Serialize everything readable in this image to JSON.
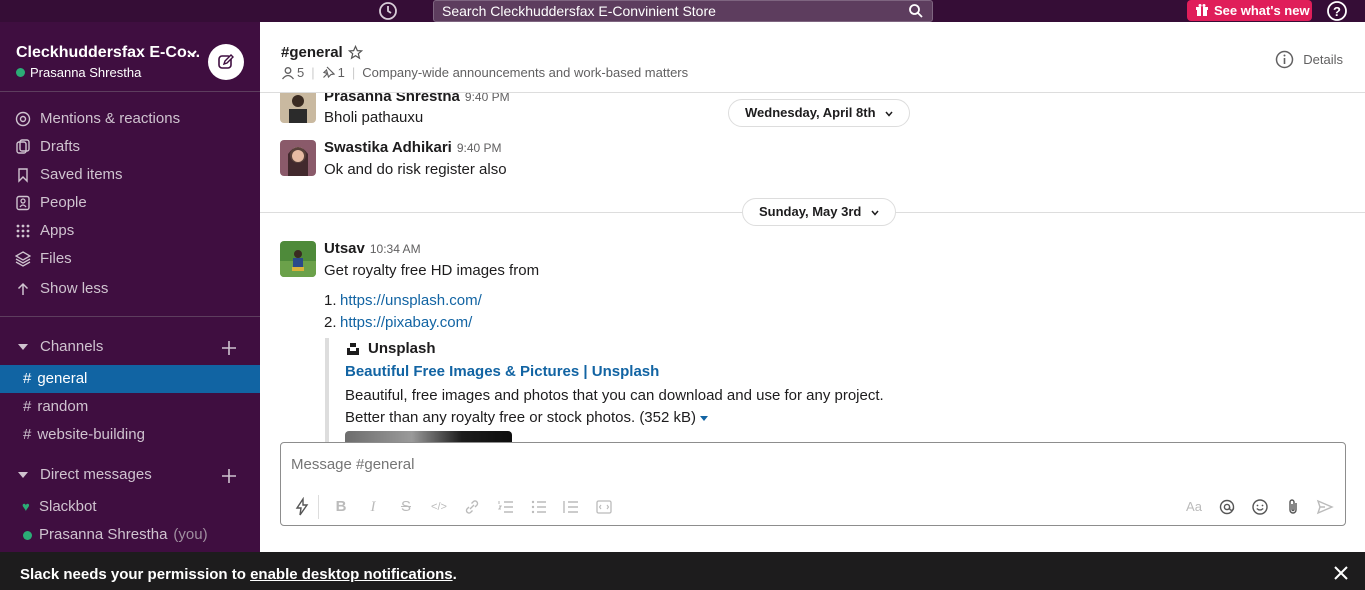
{
  "topbar": {
    "search_text": "Search Cleckhuddersfax E-Convinient Store",
    "whats_new_label": "See what's new"
  },
  "sidebar": {
    "workspace_name": "Cleckhuddersfax E-Co...",
    "current_user": "Prasanna Shrestha",
    "nav": [
      {
        "label": "Mentions & reactions",
        "icon": "at-icon"
      },
      {
        "label": "Drafts",
        "icon": "drafts-icon"
      },
      {
        "label": "Saved items",
        "icon": "bookmark-icon"
      },
      {
        "label": "People",
        "icon": "people-icon"
      },
      {
        "label": "Apps",
        "icon": "apps-grid-icon"
      },
      {
        "label": "Files",
        "icon": "files-stack-icon"
      },
      {
        "label": "Show less",
        "icon": "arrow-up-icon"
      }
    ],
    "channels_header": "Channels",
    "channels": [
      {
        "name": "general",
        "active": true
      },
      {
        "name": "random",
        "active": false
      },
      {
        "name": "website-building",
        "active": false
      }
    ],
    "dms_header": "Direct messages",
    "dms": [
      {
        "name": "Slackbot",
        "suffix": ""
      },
      {
        "name": "Prasanna Shrestha",
        "suffix": "(you)"
      }
    ]
  },
  "channel": {
    "title": "#general",
    "members": "5",
    "pinned": "1",
    "topic": "Company-wide announcements and work-based matters",
    "details_label": "Details"
  },
  "messages": {
    "date1": "Wednesday, April 8th",
    "date2": "Sunday, May 3rd",
    "m1": {
      "author": "Prasanna Shrestha",
      "time": "9:40 PM",
      "text": "Bholi pathauxu"
    },
    "m2": {
      "author": "Swastika Adhikari",
      "time": "9:40 PM",
      "text": "Ok and do risk register also"
    },
    "m3": {
      "author": "Utsav",
      "time": "10:34 AM",
      "text": "Get royalty free HD images from",
      "links": [
        {
          "num": "1.",
          "url": "https://unsplash.com/"
        },
        {
          "num": "2.",
          "url": "https://pixabay.com/"
        }
      ],
      "unfurl": {
        "source": "Unsplash",
        "title": "Beautiful Free Images & Pictures | Unsplash",
        "desc1": "Beautiful, free images and photos that you can download and use for any project.",
        "desc2": "Better than any royalty free or stock photos. (352 kB)"
      }
    }
  },
  "composer": {
    "placeholder": "Message #general",
    "font_label": "Aa"
  },
  "banner": {
    "prefix": "Slack needs your permission to ",
    "link": "enable desktop notifications",
    "suffix": "."
  },
  "colors": {
    "sidebar_bg": "#3f0e40",
    "topbar_bg": "#350d36",
    "active_channel": "#1164a3",
    "link": "#1264a3",
    "whats_new": "#e01e5a",
    "presence": "#2bac76"
  }
}
